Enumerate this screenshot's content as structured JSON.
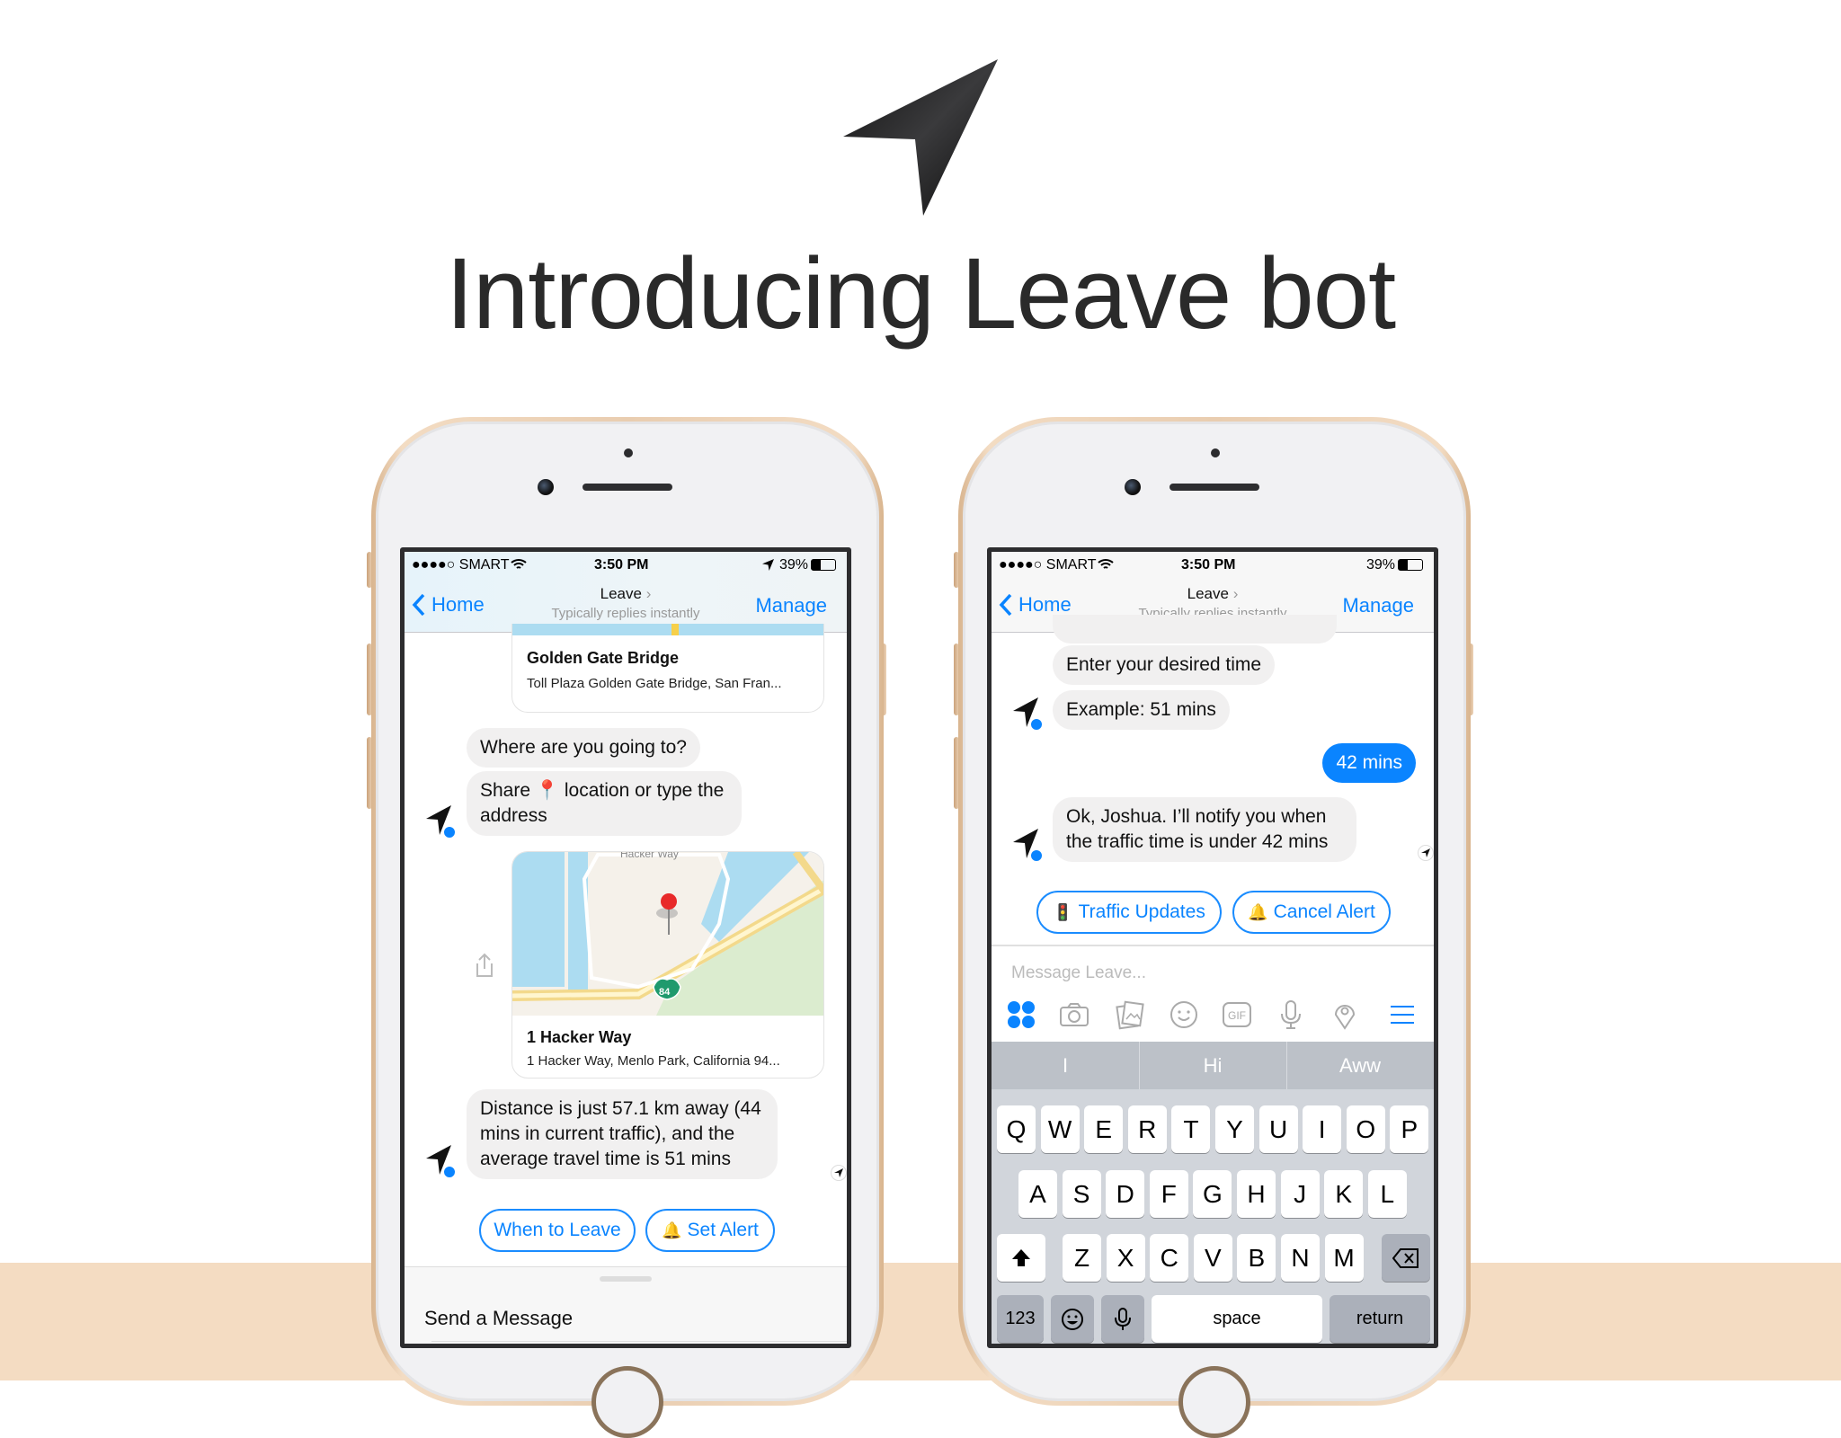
{
  "headline": "Introducing Leave bot",
  "colors": {
    "accent": "#0a84ff",
    "bubble": "#f1f0f0",
    "band": "#f4dcc2",
    "keyboard": "#d1d5db"
  },
  "left_phone": {
    "status": {
      "carrier": "●●●●○ SMART",
      "time": "3:50 PM",
      "battery": "39%"
    },
    "nav": {
      "back": "Home",
      "title": "Leave",
      "subtitle": "Typically replies instantly",
      "action": "Manage"
    },
    "card1": {
      "title": "Golden Gate Bridge",
      "address": "Toll Plaza Golden Gate Bridge, San Fran..."
    },
    "msg1": "Where are you going to?",
    "msg2_a": "Share",
    "msg2_b": "location or type the address",
    "map": {
      "road_label": "Hacker Way",
      "shield": "84"
    },
    "card2": {
      "title": "1 Hacker Way",
      "address": "1 Hacker Way, Menlo Park, California 94..."
    },
    "msg3": "Distance is just 57.1 km away (44 mins in current traffic), and the average travel time is 51 mins",
    "quick_replies": [
      {
        "label": "When to Leave"
      },
      {
        "label": "Set Alert",
        "icon": "🔔"
      }
    ],
    "composer": "Send a Message"
  },
  "right_phone": {
    "status": {
      "carrier": "●●●●○ SMART",
      "time": "3:50 PM",
      "battery": "39%"
    },
    "nav": {
      "back": "Home",
      "title": "Leave",
      "subtitle": "Typically replies instantly",
      "action": "Manage"
    },
    "msg1": "Enter your desired time",
    "msg2": "Example: 51 mins",
    "user_msg": "42 mins",
    "msg3": "Ok, Joshua. I’ll notify you when the traffic time is under 42 mins",
    "quick_replies": [
      {
        "label": "Traffic Updates",
        "icon": "🚦"
      },
      {
        "label": "Cancel Alert",
        "icon": "🔔"
      }
    ],
    "input_placeholder": "Message Leave...",
    "toolbar_icons": [
      "emoji-grid-icon",
      "camera-icon",
      "gallery-icon",
      "smiley-icon",
      "gif-icon",
      "microphone-icon",
      "location-pin-icon",
      "menu-icon"
    ],
    "gif_label": "GIF",
    "suggestions": [
      "I",
      "Hi",
      "Aww"
    ],
    "keyboard": {
      "row1": [
        "Q",
        "W",
        "E",
        "R",
        "T",
        "Y",
        "U",
        "I",
        "O",
        "P"
      ],
      "row2": [
        "A",
        "S",
        "D",
        "F",
        "G",
        "H",
        "J",
        "K",
        "L"
      ],
      "row3": [
        "Z",
        "X",
        "C",
        "V",
        "B",
        "N",
        "M"
      ],
      "numbers": "123",
      "space": "space",
      "return": "return"
    }
  }
}
